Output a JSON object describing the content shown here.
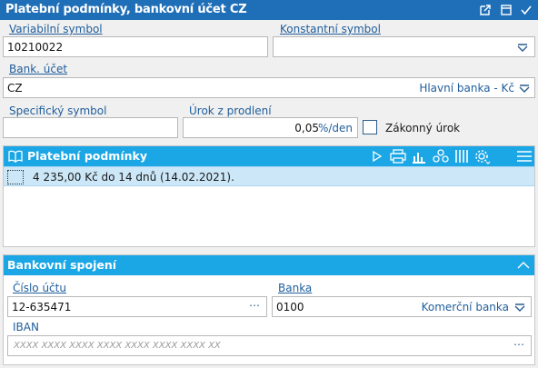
{
  "window": {
    "title": "Platební podmínky, bankovní účet CZ",
    "icons": [
      "external-link-icon",
      "maximize-icon",
      "check-icon"
    ]
  },
  "form": {
    "variabilni_symbol": {
      "label": "Variabilní symbol",
      "value": "10210022"
    },
    "konstantni_symbol": {
      "label": "Konstantní symbol",
      "value": ""
    },
    "bank_ucet": {
      "label": "Bank. účet",
      "value": "CZ",
      "bank_name": "Hlavní banka - Kč"
    },
    "specificky_symbol": {
      "label": "Specifický symbol",
      "value": ""
    },
    "urok_z_prodleni": {
      "label": "Úrok z prodlení",
      "value": "0,05",
      "unit": "%/den"
    },
    "zakonny_urok": {
      "label": "Zákonný úrok",
      "checked": false
    }
  },
  "platebni_podminky": {
    "title": "Platební podmínky",
    "rows": [
      {
        "text": "4 235,00 Kč do 14 dnů (14.02.2021)."
      }
    ],
    "toolbar_icons": [
      "play-icon",
      "printer-icon",
      "chart-icon",
      "grouping-icon",
      "columns-icon",
      "settings-icon",
      "menu-icon"
    ]
  },
  "bankovni_spojeni": {
    "title": "Bankovní spojení",
    "cislo_uctu": {
      "label": "Číslo účtu",
      "value": "12-635471"
    },
    "banka": {
      "label": "Banka",
      "value": "0100",
      "bank_name": "Komerční banka"
    },
    "iban": {
      "label": "IBAN",
      "placeholder": "XXXX XXXX XXXX XXXX XXXX XXXX XXXX XX"
    }
  },
  "colors": {
    "titlebar": "#1f6fb8",
    "section_header": "#1ba6e6",
    "label": "#1f5e9c",
    "selected_row": "#cce8f8"
  }
}
